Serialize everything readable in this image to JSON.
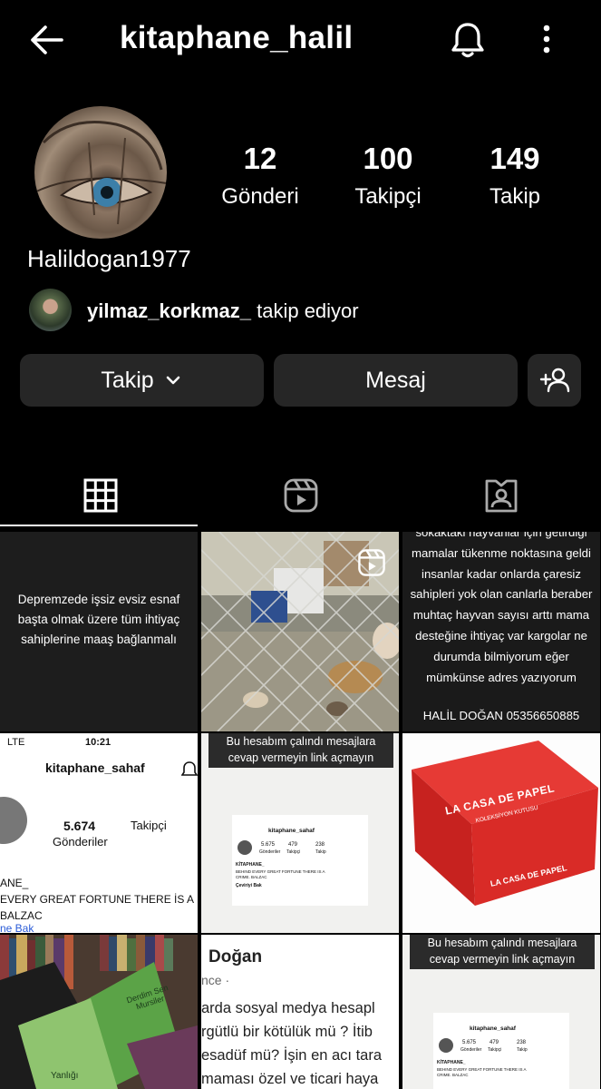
{
  "header": {
    "title": "kitaphane_halil"
  },
  "profile": {
    "stats": [
      {
        "value": "12",
        "label": "Gönderi"
      },
      {
        "value": "100",
        "label": "Takipçi"
      },
      {
        "value": "149",
        "label": "Takip"
      }
    ],
    "full_name": "Halildogan1977",
    "followed_by": {
      "username": "yilmaz_korkmaz_",
      "suffix": " takip ediyor"
    }
  },
  "buttons": {
    "follow": "Takip",
    "message": "Mesaj"
  },
  "posts": {
    "p1_text": "Depremzede işsiz evsiz esnaf başta olmak üzere tüm ihtiyaç sahiplerine maaş bağlanmalı",
    "p3_text": "sokaktaki hayvanlar için getirdiği mamalar tükenme noktasına geldi insanlar kadar onlarda çaresiz sahipleri yok olan canlarla beraber muhtaç hayvan sayısı arttı mama desteğine ihtiyaç var kargolar ne durumda bilmiyorum eğer mümkünse adres yazıyorum",
    "p3_phone": "HALİL DOĞAN 05356650885",
    "p4": {
      "status_left": "LTE",
      "time": "10:21",
      "account": "kitaphane_sahaf",
      "count": "5.674",
      "label_posts": "Gönderiler",
      "label_followers": "Takipçi",
      "line1": "ANE_",
      "line2": "EVERY GREAT FORTUNE THERE İS A",
      "line3": "BALZAC",
      "line4": "ne Bak"
    },
    "p5": {
      "warning": "Bu hesabım çalındı mesajlara cevap vermeyin link açmayın",
      "account": "kitaphane_sahaf",
      "stats": [
        "5.675",
        "479",
        "238"
      ],
      "stat_labels": [
        "Gönderiler",
        "Takipçi",
        "Takip"
      ],
      "bio1": "KİTAPHANE_",
      "bio2": "BEHIND EVERY GREAT FORTUNE THERE IS A CRIME. BALZAC",
      "bio3": "Çeviriyi Bak"
    },
    "p6": {
      "brand": "LA CASA DE PAPEL",
      "subtitle": "KOLEKSİYON KUTUSU"
    },
    "p7": {
      "book1": "Yanlığı",
      "book2": "Derdim Sen Mursiler"
    },
    "p8": {
      "name": "Doğan",
      "meta": "nce ·",
      "lines": [
        "arda sosyal medya hesapl",
        "rgütlü bir kötülük mü ? İtib",
        "esadüf mü? İşin en acı tara",
        "maması özel ve ticari haya"
      ]
    },
    "p9": {
      "warning": "Bu hesabım çalındı mesajlara cevap vermeyin link açmayın",
      "account": "kitaphane_sahaf",
      "stats": [
        "5.675",
        "479",
        "238"
      ],
      "stat_labels": [
        "Gönderiler",
        "Takipçi",
        "Takip"
      ],
      "bio1": "KİTAPHANE_",
      "bio2": "BEHIND EVERY GREAT FORTUNE THERE IS A CRIME. BALZAC"
    }
  },
  "colors": {
    "background": "#000000",
    "button": "#262626",
    "text": "#ffffff"
  },
  "icons": [
    "back-arrow-icon",
    "bell-icon",
    "more-vertical-icon",
    "chevron-down-icon",
    "add-person-icon",
    "grid-icon",
    "reels-icon",
    "tagged-icon",
    "reel-play-icon"
  ]
}
